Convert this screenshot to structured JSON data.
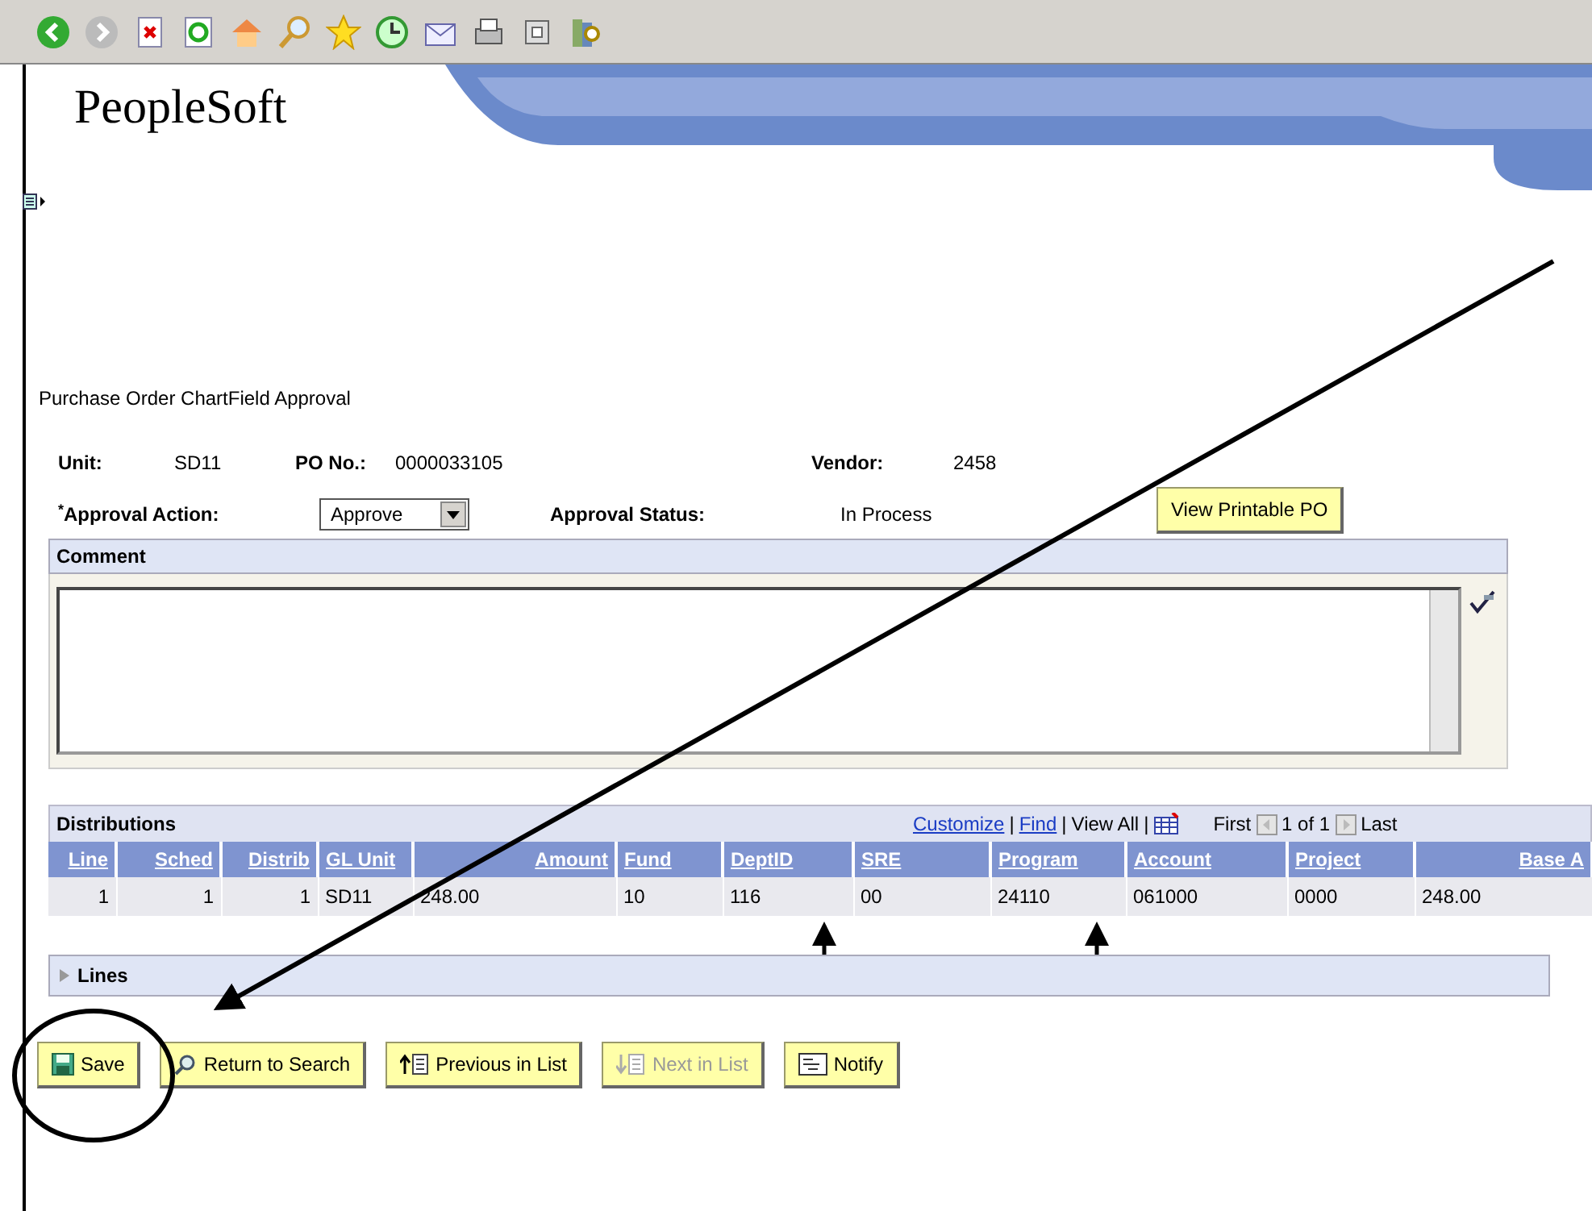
{
  "logo": "PeopleSoft",
  "page_title": "Purchase Order ChartField Approval",
  "header_fields": [
    {
      "label": "Unit:",
      "value": "SD11"
    },
    {
      "label": "PO No.:",
      "value": "0000033105"
    },
    {
      "label": "Vendor:",
      "value": "2458"
    }
  ],
  "approval": {
    "required_mark": "*",
    "label": "Approval Action:",
    "value": "Approve",
    "status_label": "Approval Status:",
    "status": "In Process",
    "button": "View Printable PO"
  },
  "comment": {
    "label": "Comment"
  },
  "distributions": {
    "title": "Distributions",
    "links": [
      {
        "label": "Customize",
        "kind": "link"
      },
      {
        "label": "|",
        "kind": "separator"
      },
      {
        "label": "Find",
        "kind": "link"
      },
      {
        "label": "|",
        "kind": "separator"
      },
      {
        "label": "View All",
        "kind": "text"
      },
      {
        "label": "|",
        "kind": "separator"
      }
    ],
    "first": "First",
    "range": "1 of 1",
    "last": "Last",
    "columns": [
      {
        "label": "Line",
        "right_aligned": true
      },
      {
        "label": "Sched",
        "right_aligned": true
      },
      {
        "label": "Distrib",
        "right_aligned": true
      },
      {
        "label": "GL Unit",
        "right_aligned": false
      },
      {
        "label": "Amount",
        "right_aligned": true
      },
      {
        "label": "Fund",
        "right_aligned": false
      },
      {
        "label": "DeptID",
        "right_aligned": false
      },
      {
        "label": "SRE",
        "right_aligned": false
      },
      {
        "label": "Program",
        "right_aligned": false
      },
      {
        "label": "Account",
        "right_aligned": false
      },
      {
        "label": "Project",
        "right_aligned": false
      },
      {
        "label": "Base A",
        "right_aligned": true
      }
    ],
    "rows": [
      [
        "1",
        "1",
        "1",
        "SD11",
        "248.00",
        "10",
        "116",
        "00",
        "24110",
        "061000",
        "0000",
        "248.00"
      ]
    ]
  },
  "lines": {
    "label": "Lines",
    "expanded": false
  },
  "buttons": [
    {
      "label": "Save",
      "kind": "save",
      "disabled": false
    },
    {
      "label": "Return to Search",
      "kind": "search",
      "disabled": false
    },
    {
      "label": "Previous in List",
      "kind": "previous",
      "disabled": false
    },
    {
      "label": "Next in List",
      "kind": "next",
      "disabled": true
    },
    {
      "label": "Notify",
      "kind": "notify",
      "disabled": false
    }
  ]
}
